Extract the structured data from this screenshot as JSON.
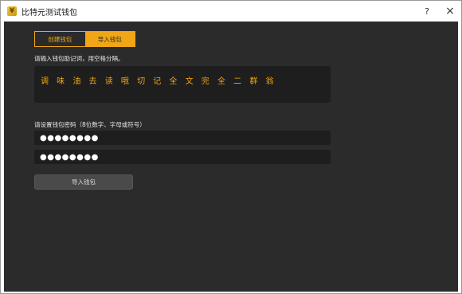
{
  "window": {
    "title": "比特元测试钱包",
    "help_label": "?",
    "close_label": "×",
    "icon_glyph": "¥"
  },
  "tabs": [
    {
      "label": "创建钱包",
      "active": false
    },
    {
      "label": "导入钱包",
      "active": true
    }
  ],
  "mnemonic": {
    "label": "请输入钱包助记词，用空格分隔。",
    "value": "调 味 油 去 读 哦 切 记 全 文 完 全 二 群 翁"
  },
  "password": {
    "label": "请设置钱包密码（8位数字、字母或符号）",
    "value": "●●●●●●●●",
    "confirm_value": "●●●●●●●●"
  },
  "import_button": {
    "label": "导入钱包"
  },
  "colors": {
    "accent": "#f0a617",
    "background": "#2b2b2b",
    "field": "#1e1e1e"
  }
}
